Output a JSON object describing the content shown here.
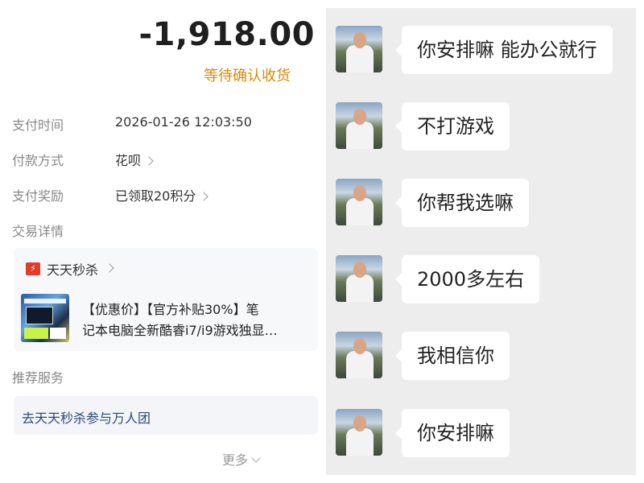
{
  "order": {
    "amount": "-1,918.00",
    "status": "等待确认收货",
    "rows": [
      {
        "label": "支付时间",
        "value": "2026-01-26 12:03:50"
      },
      {
        "label": "付款方式",
        "value": "花呗"
      },
      {
        "label": "支付奖励",
        "value": "已领取20积分"
      },
      {
        "label": "交易详情",
        "value": ""
      }
    ],
    "product": {
      "section_label": "天天秒杀",
      "title_line1": "【优惠价】【官方补贴30%】笔",
      "title_line2": "记本电脑全新酷睿i7/i9游戏独显…"
    },
    "recommend_label": "推荐服务",
    "recommend_link": "去天天秒杀参与万人团",
    "more_label": "更多"
  },
  "chat": {
    "messages": [
      {
        "text": "你安排嘛  能办公就行"
      },
      {
        "text": "不打游戏"
      },
      {
        "text": "你帮我选嘛"
      },
      {
        "text": "2000多左右"
      },
      {
        "text": "我相信你"
      },
      {
        "text": "你安排嘛"
      }
    ]
  },
  "colors": {
    "status": "#d98a0a",
    "link": "#2b4a7a",
    "chat_bg": "#ededed"
  },
  "icons": [
    "cart-icon",
    "chevron-right-icon",
    "chevron-down-icon",
    "avatar"
  ]
}
